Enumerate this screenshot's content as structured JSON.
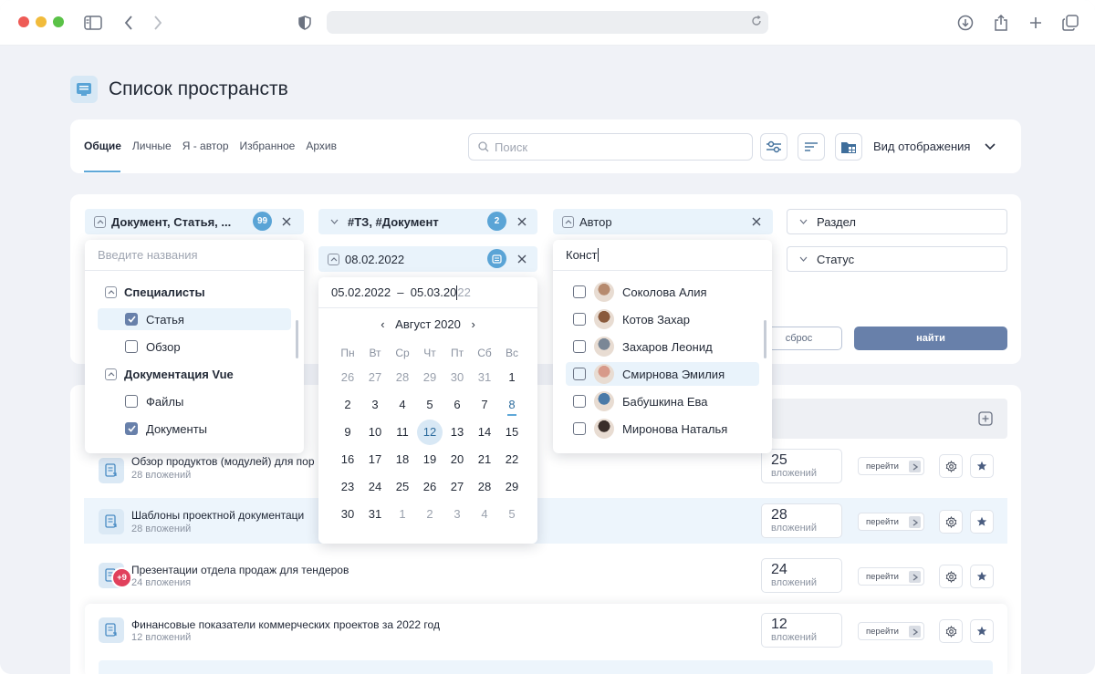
{
  "page": {
    "title": "Список пространств"
  },
  "tabs": [
    {
      "label": "Общие",
      "active": true
    },
    {
      "label": "Личные"
    },
    {
      "label": "Я - автор"
    },
    {
      "label": "Избранное"
    },
    {
      "label": "Архив"
    }
  ],
  "search": {
    "placeholder": "Поиск"
  },
  "view": {
    "label": "Вид отображения"
  },
  "filters": {
    "types": {
      "label": "Документ, Статья, ...",
      "count": "99"
    },
    "tags": {
      "label": "#ТЗ, #Документ",
      "count": "2"
    },
    "author": {
      "label": "Автор"
    },
    "section": {
      "label": "Раздел"
    },
    "date": {
      "label": "08.02.2022"
    },
    "status": {
      "label": "Статус"
    }
  },
  "buttons": {
    "reset": "сброс",
    "find": "найти"
  },
  "type_popup": {
    "placeholder": "Введите названия",
    "groups": [
      {
        "label": "Специалисты",
        "options": [
          {
            "label": "Статья",
            "checked": true
          },
          {
            "label": "Обзор",
            "checked": false
          }
        ]
      },
      {
        "label": "Документация Vue",
        "options": [
          {
            "label": "Файлы",
            "checked": false
          },
          {
            "label": "Документы",
            "checked": true
          }
        ]
      }
    ]
  },
  "calendar": {
    "range_text": "05.02.2022  –  05.03.20",
    "range_rest": "22",
    "month": "Август 2020",
    "weekdays": [
      "Пн",
      "Вт",
      "Ср",
      "Чт",
      "Пт",
      "Сб",
      "Вс"
    ],
    "weeks": [
      [
        "26",
        "27",
        "28",
        "29",
        "30",
        "31",
        "1"
      ],
      [
        "2",
        "3",
        "4",
        "5",
        "6",
        "7",
        "8"
      ],
      [
        "9",
        "10",
        "11",
        "12",
        "13",
        "14",
        "15"
      ],
      [
        "16",
        "17",
        "18",
        "19",
        "20",
        "21",
        "22"
      ],
      [
        "23",
        "24",
        "25",
        "26",
        "27",
        "28",
        "29"
      ],
      [
        "30",
        "31",
        "1",
        "2",
        "3",
        "4",
        "5"
      ]
    ],
    "today": "12",
    "marked": "8"
  },
  "author_popup": {
    "query": "Конст",
    "people": [
      {
        "name": "Соколова Алия",
        "color": "#b68a6e"
      },
      {
        "name": "Котов Захар",
        "color": "#8a5a3c"
      },
      {
        "name": "Захаров Леонид",
        "color": "#7a8796"
      },
      {
        "name": "Смирнова Эмилия",
        "color": "#d79a8a"
      },
      {
        "name": "Бабушкина Ева",
        "color": "#4a7aa8"
      },
      {
        "name": "Миронова Наталья",
        "color": "#3a2e2a"
      }
    ]
  },
  "rows": [
    {
      "title": "Обзор продуктов (модулей) для пор",
      "sub": "28 вложений",
      "count": "25",
      "count_label": "вложений",
      "goto": "перейти"
    },
    {
      "title": "Шаблоны проектной документаци",
      "sub": "28 вложений",
      "count": "28",
      "count_label": "вложений",
      "goto": "перейти"
    },
    {
      "title": "Презентации отдела продаж для тендеров",
      "sub": "24 вложения",
      "count": "24",
      "count_label": "вложений",
      "goto": "перейти",
      "badge": "+9"
    },
    {
      "title": "Финансовые показатели коммерческих проектов за 2022 год",
      "sub": "12 вложений",
      "count": "12",
      "count_label": "вложений",
      "goto": "перейти"
    }
  ],
  "colors": {
    "accent": "#5aa4d6",
    "primary_button": "#6880aa",
    "badge_red": "#e1405c"
  }
}
